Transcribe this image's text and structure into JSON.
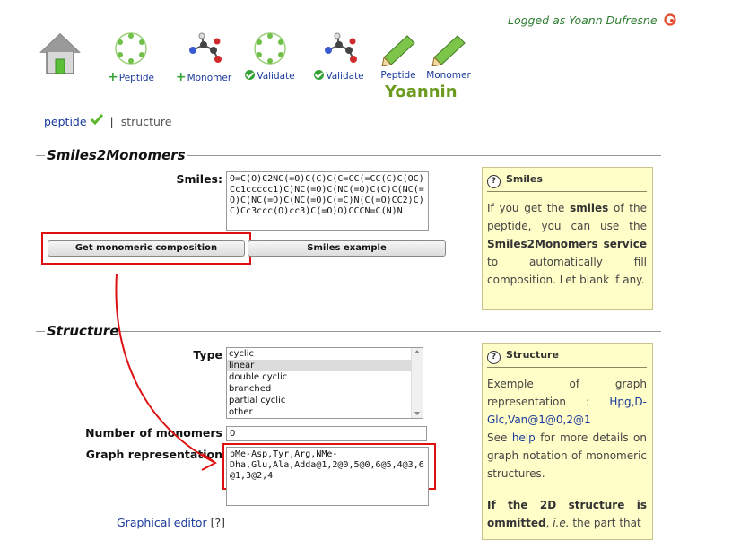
{
  "header": {
    "logged_as": "Logged as Yoann Dufresne",
    "username": "Yoannin"
  },
  "nav": [
    {
      "label": "Peptide",
      "icon": "peptide-ring-icon",
      "prefix": "plus"
    },
    {
      "label": "Monomer",
      "icon": "molecule-icon",
      "prefix": "plus"
    },
    {
      "label": "Validate",
      "icon": "peptide-ring-icon",
      "prefix": "check"
    },
    {
      "label": "Validate",
      "icon": "molecule-icon",
      "prefix": "check"
    },
    {
      "label": "Peptide",
      "icon": "pencil-icon",
      "prefix": ""
    },
    {
      "label": "Monomer",
      "icon": "pencil-icon",
      "prefix": ""
    }
  ],
  "breadcrumb": {
    "link": "peptide",
    "separator": "|",
    "current": "structure"
  },
  "smiles_section": {
    "title": "Smiles2Monomers",
    "label": "Smiles:",
    "value": "O=C(O)C2NC(=O)C(C)C(C=CC(=CC(C)C(OC)Cc1ccccc1)C)NC(=O)C(NC(=O)C(C)C(NC(=O)C(NC(=O)C(NC(=O)C(=C)N(C(=O)CC2)C)C)Cc3ccc(O)cc3)C(=O)O)CCCN=C(N)N",
    "get_button": "Get monomeric composition",
    "example_button": "Smiles example",
    "help": {
      "title": "Smiles",
      "t1": "If you get the ",
      "b1": "smiles",
      "t2": " of the peptide, you can use the ",
      "b2": "Smiles2Monomers service",
      "t3": " to automatically fill composition. Let blank if any."
    }
  },
  "structure_section": {
    "title": "Structure",
    "type_label": "Type",
    "type_options": [
      "cyclic",
      "linear",
      "double cyclic",
      "branched",
      "partial cyclic",
      "other"
    ],
    "type_selected": "linear",
    "monomers_label": "Number of monomers",
    "monomers_value": "0",
    "graph_label": "Graph representation",
    "graph_value": "bMe-Asp,Tyr,Arg,NMe-Dha,Glu,Ala,Adda@1,2@0,5@0,6@5,4@3,6@1,3@2,4",
    "editor_link": "Graphical editor",
    "editor_help": "[?]",
    "help": {
      "title": "Structure",
      "t1": "Exemple of graph representation : ",
      "example": "Hpg,D-Glc,Van@1@0,2@1",
      "t2": "See ",
      "help_link": "help",
      "t3": " for more details on graph notation of monomeric structures.",
      "b1": "If the 2D structure is ommitted",
      "t4": ", ",
      "i1": "i.e.",
      "t5": " the part that"
    }
  },
  "colors": {
    "accent": "#6b9a1e",
    "link": "#1a3a9a",
    "annotation": "#dd1111",
    "help_bg": "#fffdc8"
  }
}
